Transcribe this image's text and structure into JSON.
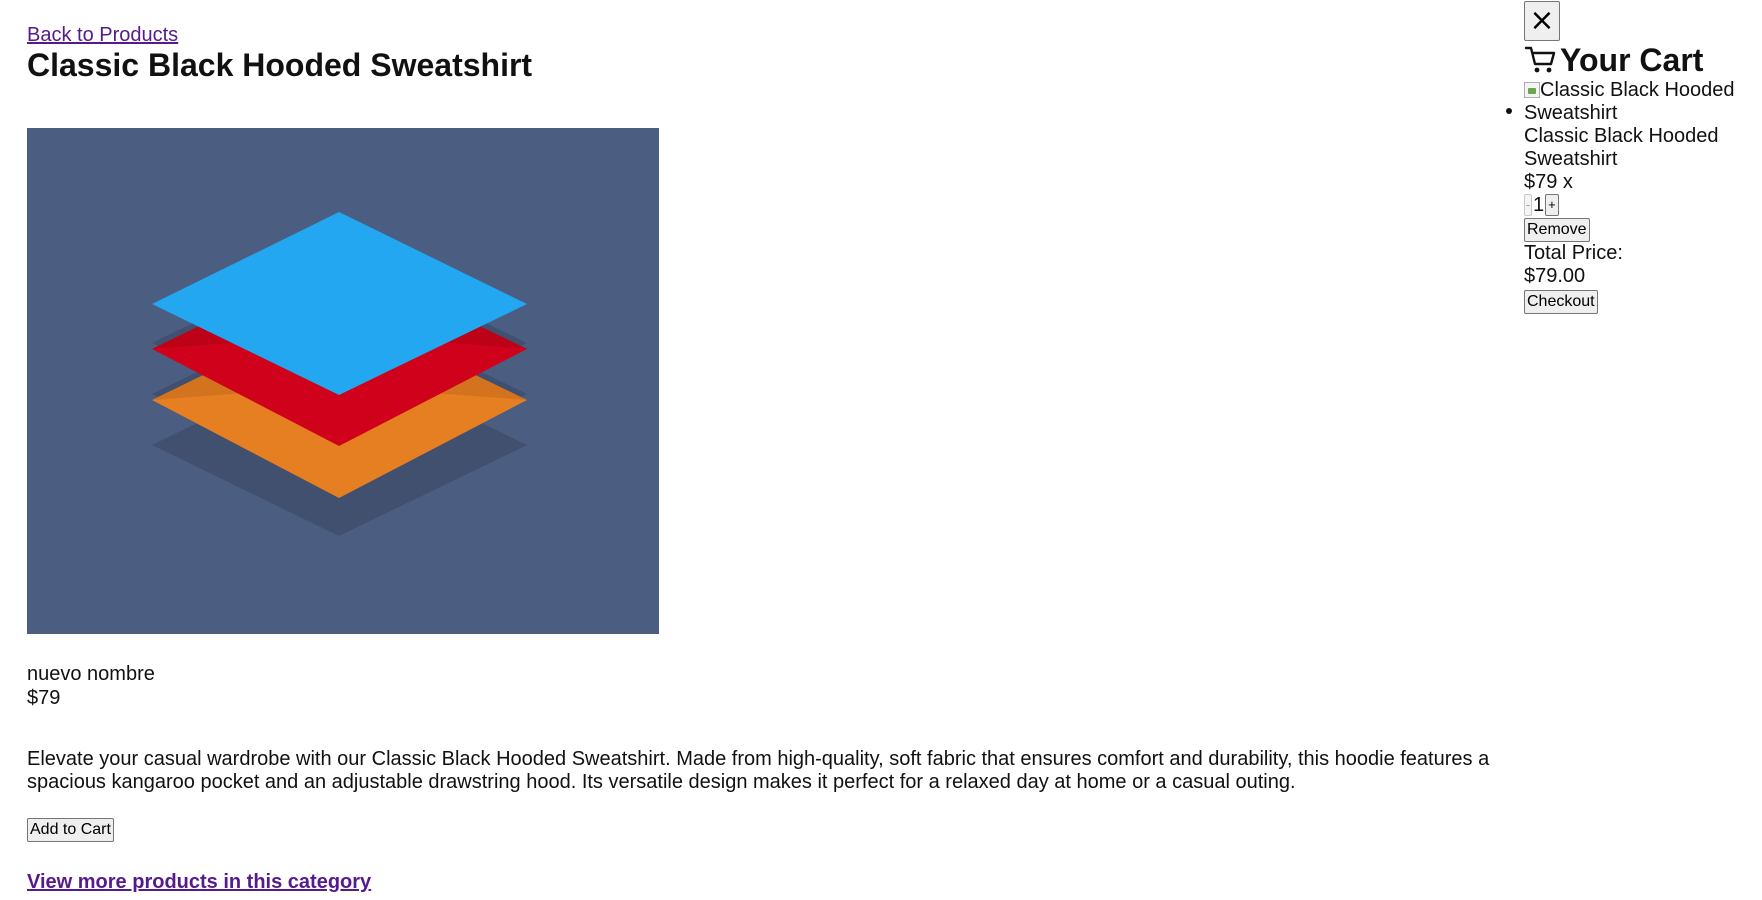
{
  "product_page": {
    "back_link": "Back to Products",
    "title": "Classic Black Hooded Sweatshirt",
    "image_alt": "Classic Black Hooded Sweatshirt",
    "name": "nuevo nombre",
    "price": "$79",
    "description": "Elevate your casual wardrobe with our Classic Black Hooded Sweatshirt. Made from high-quality, soft fabric that ensures comfort and durability, this hoodie features a spacious kangaroo pocket and an adjustable drawstring hood. Its versatile design makes it perfect for a relaxed day at home or a casual outing.",
    "add_to_cart_label": "Add to Cart",
    "category_link": "View more products in this category",
    "image_colors": {
      "background": "#4b5d80",
      "layer_top": "#22a7f0",
      "layer_middle": "#d0021b",
      "layer_bottom": "#e67e22"
    }
  },
  "cart": {
    "close_label": "×",
    "close_icon": "close-icon",
    "cart_icon": "cart-icon",
    "title": "Your Cart",
    "items": [
      {
        "image_alt": "Classic Black Hooded Sweatshirt",
        "name": "Classic Black Hooded Sweatshirt",
        "price_text": "$79 x",
        "decrement_label": "-",
        "quantity": "1",
        "increment_label": "+",
        "remove_label": "Remove"
      }
    ],
    "total_label": "Total Price:",
    "total_value": "$79.00",
    "checkout_label": "Checkout"
  }
}
